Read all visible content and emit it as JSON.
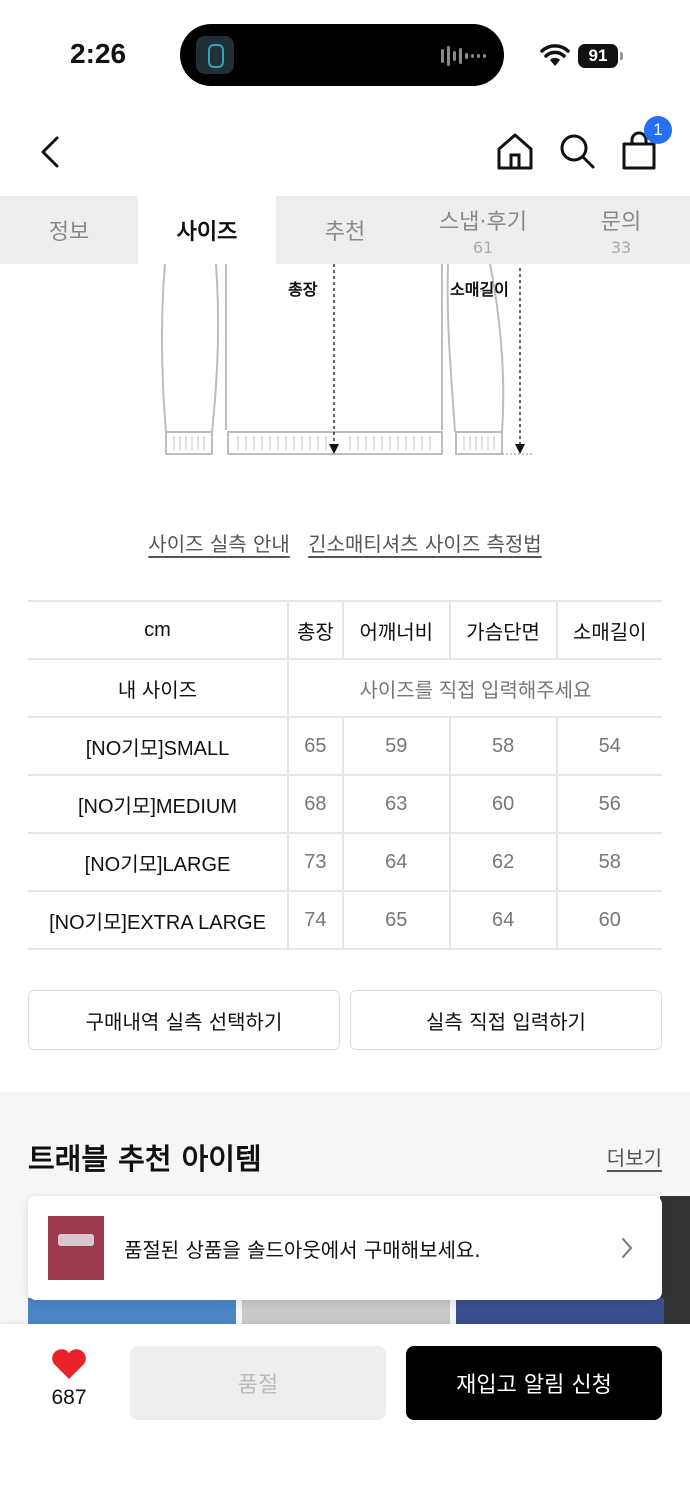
{
  "status_bar": {
    "time": "2:26",
    "battery": "91"
  },
  "header": {
    "cart_count": "1"
  },
  "tabs": [
    {
      "label": "정보",
      "count": ""
    },
    {
      "label": "사이즈",
      "count": ""
    },
    {
      "label": "추천",
      "count": ""
    },
    {
      "label": "스냅·후기",
      "count": "61"
    },
    {
      "label": "문의",
      "count": "33"
    }
  ],
  "diagram": {
    "length_label": "총장",
    "sleeve_label": "소매길이"
  },
  "links": {
    "size_guide": "사이즈 실측 안내",
    "measure_method": "긴소매티셔츠 사이즈 측정법"
  },
  "size_table": {
    "unit": "cm",
    "columns": [
      "총장",
      "어깨너비",
      "가슴단면",
      "소매길이"
    ],
    "my_size": {
      "label": "내 사이즈",
      "prompt": "사이즈를 직접 입력해주세요"
    },
    "rows": [
      {
        "name": "[NO기모]SMALL",
        "values": [
          "65",
          "59",
          "58",
          "54"
        ]
      },
      {
        "name": "[NO기모]MEDIUM",
        "values": [
          "68",
          "63",
          "60",
          "56"
        ]
      },
      {
        "name": "[NO기모]LARGE",
        "values": [
          "73",
          "64",
          "62",
          "58"
        ]
      },
      {
        "name": "[NO기모]EXTRA LARGE",
        "values": [
          "74",
          "65",
          "64",
          "60"
        ]
      }
    ]
  },
  "actions": {
    "select_history": "구매내역 실측 선택하기",
    "direct_input": "실측 직접 입력하기"
  },
  "recommend": {
    "title": "트래블 추천 아이템",
    "more": "더보기"
  },
  "toast": {
    "message": "품절된 상품을 솔드아웃에서 구매해보세요."
  },
  "bottom_bar": {
    "like_count": "687",
    "soldout_label": "품절",
    "notify_label": "재입고 알림 신청"
  },
  "colors": {
    "badge": "#2370f6",
    "heart": "#e8222a",
    "notify_bg": "#000000"
  }
}
